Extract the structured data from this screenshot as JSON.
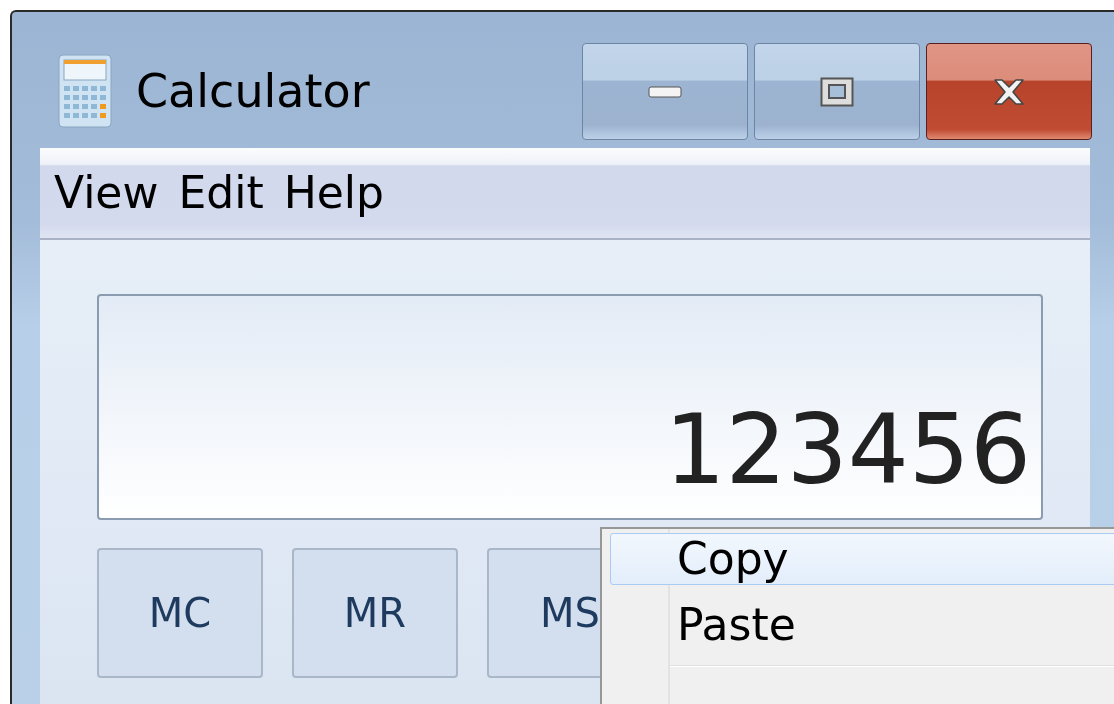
{
  "window": {
    "title": "Calculator"
  },
  "menu_bar": [
    {
      "label": "View"
    },
    {
      "label": "Edit"
    },
    {
      "label": "Help"
    }
  ],
  "display": {
    "value": "123456"
  },
  "memory_buttons": [
    {
      "label": "MC"
    },
    {
      "label": "MR"
    },
    {
      "label": "MS"
    }
  ],
  "context_menu": [
    {
      "kind": "item",
      "label": "Copy",
      "selected": true
    },
    {
      "kind": "item",
      "label": "Paste",
      "selected": false
    },
    {
      "kind": "separator"
    }
  ]
}
